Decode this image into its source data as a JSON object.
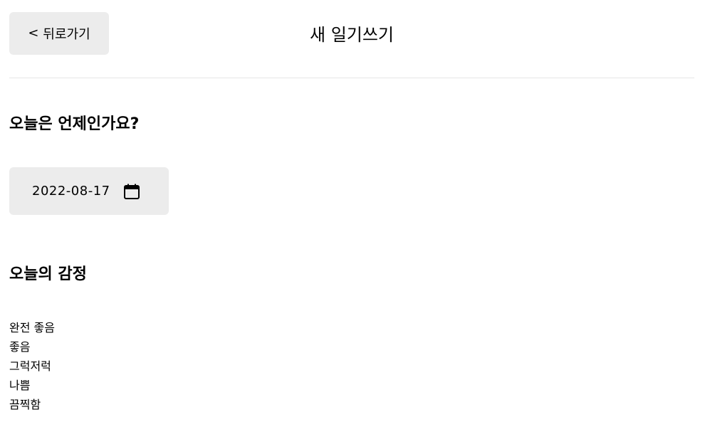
{
  "header": {
    "back_label": "뒤로가기",
    "back_icon": "chevron-left-icon",
    "title": "새 일기쓰기"
  },
  "date_section": {
    "title": "오늘은 언제인가요?",
    "value": "2022-08-17",
    "icon": "calendar-icon"
  },
  "emotion_section": {
    "title": "오늘의 감정",
    "items": [
      "완전 좋음",
      "좋음",
      "그럭저럭",
      "나쁨",
      "끔찍함"
    ]
  },
  "colors": {
    "button_bg": "#ececec",
    "divider": "#e6e6e6",
    "text": "#000000"
  }
}
